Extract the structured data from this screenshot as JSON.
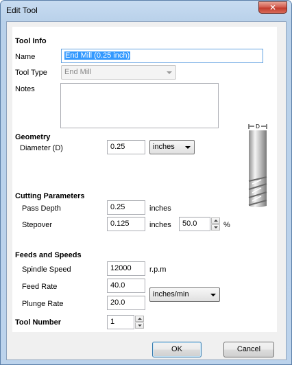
{
  "window": {
    "title": "Edit Tool",
    "close_glyph": "✕"
  },
  "tool_info": {
    "section": "Tool Info",
    "name_label": "Name",
    "name_value": "End Mill (0.25 inch)",
    "type_label": "Tool Type",
    "type_value": "End Mill",
    "notes_label": "Notes",
    "notes_value": ""
  },
  "geometry": {
    "section": "Geometry",
    "diameter_label": "Diameter (D)",
    "diameter_value": "0.25",
    "units_value": "inches",
    "diagram_label": "D"
  },
  "cutting": {
    "section": "Cutting Parameters",
    "pass_depth_label": "Pass Depth",
    "pass_depth_value": "0.25",
    "pass_depth_unit": "inches",
    "stepover_label": "Stepover",
    "stepover_value": "0.125",
    "stepover_unit": "inches",
    "stepover_percent_value": "50.0",
    "percent_sign": "%"
  },
  "feeds": {
    "section": "Feeds and Speeds",
    "spindle_label": "Spindle Speed",
    "spindle_value": "12000",
    "spindle_unit": "r.p.m",
    "feed_label": "Feed Rate",
    "feed_value": "40.0",
    "plunge_label": "Plunge Rate",
    "plunge_value": "20.0",
    "rate_units_value": "inches/min"
  },
  "tool_number": {
    "label": "Tool Number",
    "value": "1"
  },
  "buttons": {
    "ok": "OK",
    "cancel": "Cancel"
  }
}
